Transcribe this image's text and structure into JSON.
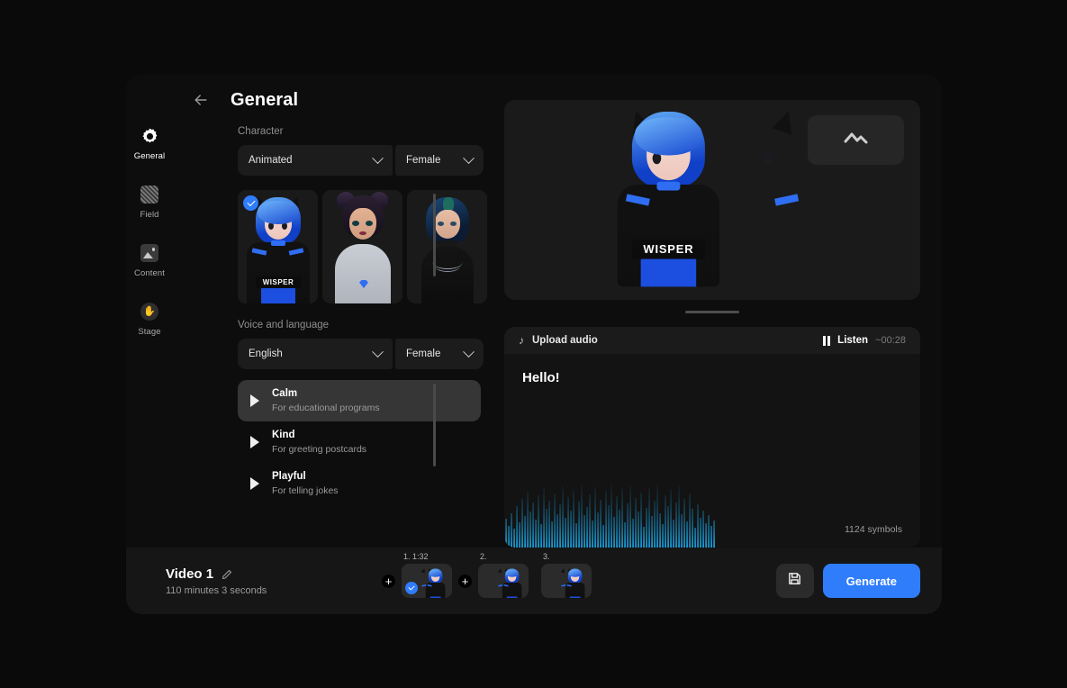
{
  "window": {
    "back_icon": "arrow-left-icon",
    "title": "General"
  },
  "sidebar": {
    "items": [
      {
        "label": "General",
        "icon": "gear-icon",
        "active": true
      },
      {
        "label": "Field",
        "icon": "hatch-pattern-icon",
        "active": false
      },
      {
        "label": "Content",
        "icon": "image-icon",
        "active": false
      },
      {
        "label": "Stage",
        "icon": "hand-icon",
        "active": false
      }
    ]
  },
  "character": {
    "section_label": "Character",
    "style_value": "Animated",
    "gender_value": "Female",
    "thumbnails": [
      {
        "name": "blue-anime-avatar",
        "selected": true,
        "shirt_text": "WISPER"
      },
      {
        "name": "tan-buns-avatar",
        "selected": false
      },
      {
        "name": "dark-bob-avatar",
        "selected": false
      }
    ]
  },
  "voice": {
    "section_label": "Voice and language",
    "language_value": "English",
    "gender_value": "Female",
    "options": [
      {
        "name": "Calm",
        "desc": "For educational programs",
        "selected": true
      },
      {
        "name": "Kind",
        "desc": "For greeting postcards",
        "selected": false
      },
      {
        "name": "Playful",
        "desc": "For telling jokes",
        "selected": false
      }
    ]
  },
  "preview": {
    "background_button_icon": "mountain-icon",
    "avatar_shirt_text": "WISPER"
  },
  "audio": {
    "upload_icon": "music-note-icon",
    "upload_label": "Upload audio",
    "pause_icon": "pause-icon",
    "listen_label": "Listen",
    "duration": "~00:28",
    "script_text": "Hello!",
    "symbols_count": "1124 symbols",
    "waveform_gradient_start": "#1f6df0",
    "waveform_gradient_end": "#17c7bf"
  },
  "bottom": {
    "video_title": "Video 1",
    "edit_icon": "pencil-icon",
    "video_duration": "110 minutes 3 seconds",
    "add_icon": "plus-icon",
    "clips": [
      {
        "label": "1. 1:32",
        "selected": true
      },
      {
        "label": "2.",
        "selected": false
      },
      {
        "label": "3.",
        "selected": false
      }
    ],
    "save_icon": "floppy-disk-icon",
    "generate_label": "Generate",
    "accent_color": "#2f7dfb"
  }
}
